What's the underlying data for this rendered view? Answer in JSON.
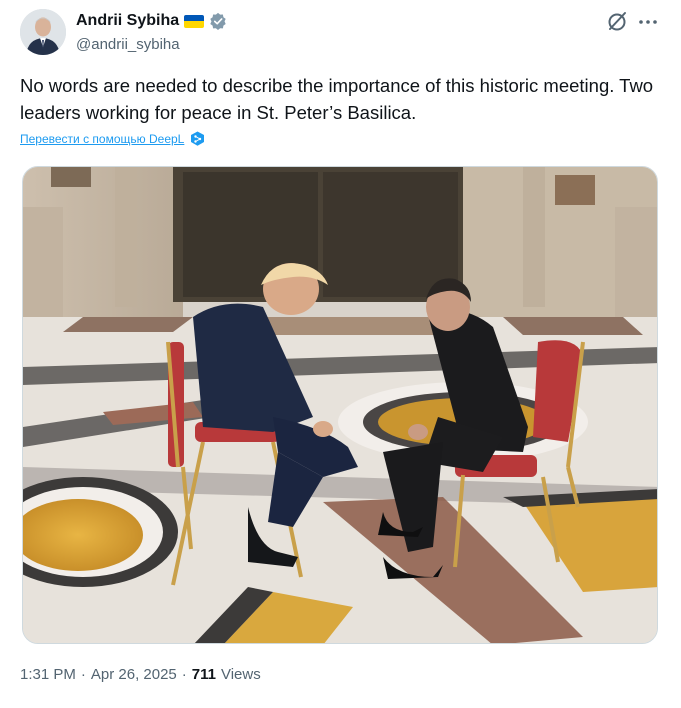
{
  "author": {
    "display_name": "Andrii Sybiha",
    "handle": "@andrii_sybiha"
  },
  "tweet": {
    "text": "No words are needed to describe the importance of this historic meeting. Two leaders working for peace in St. Peter’s Basilica.",
    "translate_label": "Перевести с помощью DeepL"
  },
  "meta": {
    "time": "1:31 PM",
    "separator1": "·",
    "date": "Apr 26, 2025",
    "separator2": "·",
    "views_count": "711",
    "views_label": "Views"
  },
  "icons": {
    "flag": "ukraine-flag-icon",
    "verified": "verified-badge-icon",
    "grok": "grok-icon",
    "more": "more-dots-icon",
    "deepl": "deepl-icon"
  },
  "colors": {
    "accent": "#1d9bf0",
    "secondary_text": "#536471",
    "primary_text": "#0f1419"
  }
}
